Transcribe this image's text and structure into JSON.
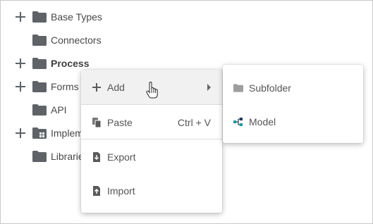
{
  "tree": {
    "items": [
      {
        "label": "Base Types",
        "expandable": true,
        "bold": false
      },
      {
        "label": "Connectors",
        "expandable": false,
        "bold": false
      },
      {
        "label": "Process",
        "expandable": true,
        "bold": true
      },
      {
        "label": "Forms",
        "expandable": true,
        "bold": false
      },
      {
        "label": "API",
        "expandable": false,
        "bold": false
      },
      {
        "label": "Implem",
        "expandable": true,
        "bold": false
      },
      {
        "label": "Librarie",
        "expandable": false,
        "bold": false
      }
    ]
  },
  "context_menu": {
    "items": [
      {
        "label": "Add",
        "icon": "plus-icon",
        "submenu": true
      },
      {
        "label": "Paste",
        "icon": "paste-icon",
        "shortcut": "Ctrl + V"
      },
      {
        "label": "Export",
        "icon": "export-icon"
      },
      {
        "label": "Import",
        "icon": "import-icon"
      }
    ]
  },
  "submenu": {
    "items": [
      {
        "label": "Subfolder",
        "icon": "folder-icon"
      },
      {
        "label": "Model",
        "icon": "model-icon"
      }
    ]
  },
  "colors": {
    "folder": "#5f6368",
    "subfolder": "#9e9e9e",
    "model_teal": "#1a9aa0",
    "model_navy": "#1f3a5f",
    "hover_bg": "#f1f1f1"
  }
}
